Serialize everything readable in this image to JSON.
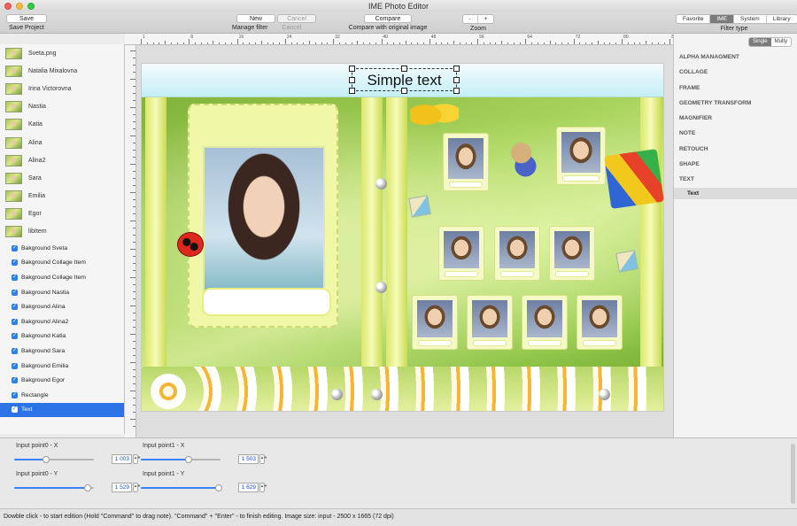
{
  "window": {
    "title": "IME Photo Editor"
  },
  "toolbar": {
    "save_button": "Save",
    "save_label": "Save Project",
    "new_button": "New",
    "cancel_button": "Cancel",
    "manage_label": "Manage filter",
    "cancel_label": "Cancel",
    "compare_button": "Compare",
    "compare_label": "Compare with original image",
    "zoom_minus": "-",
    "zoom_plus": "+",
    "zoom_label": "Zoom",
    "filter_types": [
      "Favorite",
      "IME",
      "System",
      "Library"
    ],
    "filter_type_active": "IME",
    "filter_type_label": "Filter type"
  },
  "sidebar": {
    "images": [
      "Sveta.png",
      "Natalia Mixalovna",
      "Irina Victorovna",
      "Nastia",
      "Katia",
      "Alina",
      "Alina2",
      "Sara",
      "Emilia",
      "Egor",
      "libItem"
    ],
    "layers": [
      "Bakground Sveta",
      "Bakground Collage Item",
      "Bakground Collage Item",
      "Bakground Nastia",
      "Bakground Alina",
      "Bakground Alina2",
      "Bakground Katia",
      "Bakground Sara",
      "Bakground Emilia",
      "Bakground Egor",
      "Rectangle",
      "Text"
    ],
    "selected_layer": "Text",
    "check_mark": "✓"
  },
  "ruler": {
    "labels": [
      "1",
      "8",
      "16",
      "24",
      "32",
      "40",
      "48",
      "56",
      "64",
      "72",
      "80",
      "88"
    ]
  },
  "canvas": {
    "selected_text": "Simple text"
  },
  "right_panel": {
    "modes": [
      "Single",
      "Multy"
    ],
    "mode_active": "Single",
    "filters": [
      "ALPHA MANAGMENT",
      "COLLAGE",
      "FRAME",
      "GEOMETRY TRANSFORM",
      "MAGNIFIER",
      "NOTE",
      "RETOUCH",
      "SHAPE",
      "TEXT"
    ],
    "text_sub": "Text"
  },
  "controls": {
    "point0_x": {
      "label": "Input point0 - X",
      "value": "1 003",
      "fraction": 0.4
    },
    "point0_y": {
      "label": "Input point0 - Y",
      "value": "1 529",
      "fraction": 0.92
    },
    "point1_x": {
      "label": "Input point1 - X",
      "value": "1 503",
      "fraction": 0.6
    },
    "point1_y": {
      "label": "Input point1 - Y",
      "value": "1 629",
      "fraction": 0.98
    },
    "stepper_glyph": "▲▼"
  },
  "status": {
    "text": "Dowble click - to start edition (Hold ''Command'' to drag note). ''Command'' + ''Enter'' - to finish editing.  Image size: input - 2500 x 1665 (72 dpi)"
  }
}
